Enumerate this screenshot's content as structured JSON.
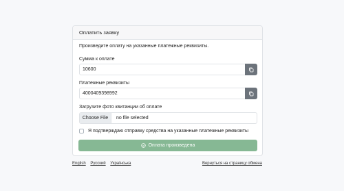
{
  "card": {
    "title": "Оплатить заявку",
    "intro": "Произведите оплату на указанные платежные реквизиты.",
    "amount_label": "Сумма к оплате",
    "amount_value": "10600",
    "details_label": "Платежные реквизиты",
    "details_value": "4000409398992",
    "upload_label": "Загрузите фото квитанции об оплате",
    "file_button": "Choose File",
    "file_status": "no file selected",
    "confirm_label": "Я подтверждаю отправку средства на указанные платежные реквизиты",
    "submit_label": "Оплата произведена"
  },
  "footer": {
    "languages": [
      "English",
      "Русский",
      "Українська"
    ],
    "back_link": "Вернуться на страницу обмена"
  },
  "icons": {
    "copy": "copy-icon",
    "submit": "check-circle-icon"
  },
  "colors": {
    "submit_bg": "#86b894",
    "copy_btn_bg": "#6c737b",
    "page_bg": "#f7f8fa"
  }
}
